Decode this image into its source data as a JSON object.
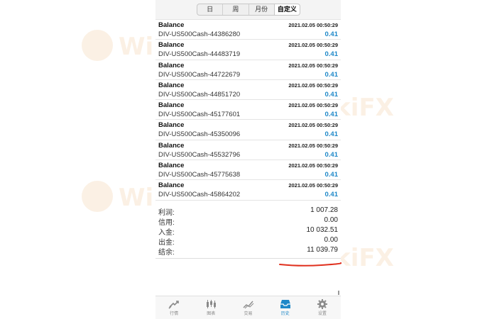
{
  "tabs": {
    "items": [
      {
        "label": "日"
      },
      {
        "label": "周"
      },
      {
        "label": "月份"
      },
      {
        "label": "自定义"
      }
    ],
    "selected": "自定义"
  },
  "deals": [
    {
      "type": "Balance",
      "time": "2021.02.05 00:50:29",
      "symbol": "DIV-US500Cash-44386280",
      "amount": "0.41"
    },
    {
      "type": "Balance",
      "time": "2021.02.05 00:50:29",
      "symbol": "DIV-US500Cash-44483719",
      "amount": "0.41"
    },
    {
      "type": "Balance",
      "time": "2021.02.05 00:50:29",
      "symbol": "DIV-US500Cash-44722679",
      "amount": "0.41"
    },
    {
      "type": "Balance",
      "time": "2021.02.05 00:50:29",
      "symbol": "DIV-US500Cash-44851720",
      "amount": "0.41"
    },
    {
      "type": "Balance",
      "time": "2021.02.05 00:50:29",
      "symbol": "DIV-US500Cash-45177601",
      "amount": "0.41"
    },
    {
      "type": "Balance",
      "time": "2021.02.05 00:50:29",
      "symbol": "DIV-US500Cash-45350096",
      "amount": "0.41"
    },
    {
      "type": "Balance",
      "time": "2021.02.05 00:50:29",
      "symbol": "DIV-US500Cash-45532796",
      "amount": "0.41"
    },
    {
      "type": "Balance",
      "time": "2021.02.05 00:50:29",
      "symbol": "DIV-US500Cash-45775638",
      "amount": "0.41"
    },
    {
      "type": "Balance",
      "time": "2021.02.05 00:50:29",
      "symbol": "DIV-US500Cash-45864202",
      "amount": "0.41"
    }
  ],
  "summary": {
    "profit": {
      "label": "利润:",
      "value": "1 007.28"
    },
    "credit": {
      "label": "信用:",
      "value": "0.00"
    },
    "deposit": {
      "label": "入金:",
      "value": "10 032.51"
    },
    "withdrawal": {
      "label": "出金:",
      "value": "0.00"
    },
    "balance": {
      "label": "结余:",
      "value": "11 039.79"
    }
  },
  "bottom_nav": {
    "items": [
      {
        "label": "行情",
        "icon": "quotes-icon"
      },
      {
        "label": "图表",
        "icon": "chart-icon"
      },
      {
        "label": "交易",
        "icon": "trade-icon"
      },
      {
        "label": "历史",
        "icon": "history-icon"
      },
      {
        "label": "设置",
        "icon": "settings-icon"
      }
    ],
    "active": "历史"
  },
  "watermark": {
    "text": "WikiFX"
  },
  "colors": {
    "accent": "#1e88c8",
    "underline": "#e0301e",
    "watermark": "#e28a2b"
  }
}
